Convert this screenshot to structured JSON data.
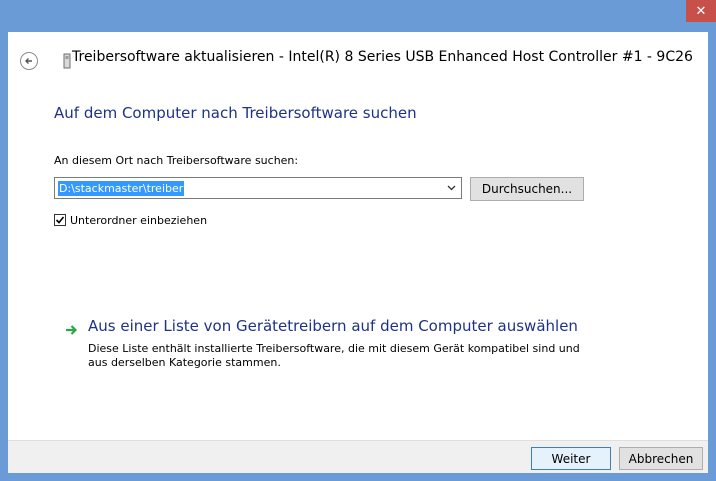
{
  "titlebar": {
    "close_glyph": "✕"
  },
  "header": {
    "title": "Treibersoftware aktualisieren - Intel(R) 8 Series USB Enhanced Host Controller #1 - 9C26",
    "back_icon": "back-arrow-icon",
    "device_icon": "usb-device-icon"
  },
  "page": {
    "heading": "Auf dem Computer nach Treibersoftware suchen",
    "path_label": "An diesem Ort nach Treibersoftware suchen:",
    "path_value": "D:\\stackmaster\\treiber",
    "browse_label": "Durchsuchen...",
    "include_subfolders_label": "Unterordner einbeziehen",
    "include_subfolders_checked": true,
    "list_link": "Aus einer Liste von Gerätetreibern auf dem Computer auswählen",
    "list_desc": "Diese Liste enthält installierte Treibersoftware, die mit diesem Gerät kompatibel sind und aus derselben Kategorie stammen."
  },
  "footer": {
    "next_label": "Weiter",
    "cancel_label": "Abbrechen"
  },
  "colors": {
    "frame": "#6b9bd6",
    "close": "#c7504b",
    "heading": "#1e3287",
    "selection": "#3399ff",
    "arrow": "#2aa845"
  }
}
